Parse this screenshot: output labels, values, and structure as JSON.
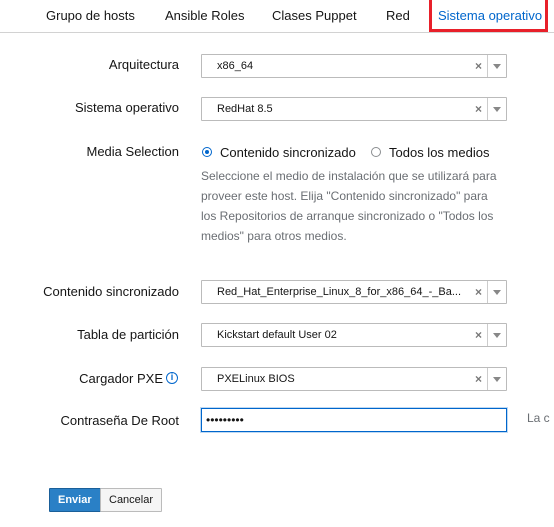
{
  "tabs": {
    "items": [
      {
        "label": "Grupo de hosts"
      },
      {
        "label": "Ansible Roles"
      },
      {
        "label": "Clases Puppet"
      },
      {
        "label": "Red"
      },
      {
        "label": "Sistema operativo",
        "active": true
      }
    ]
  },
  "form": {
    "architecture": {
      "label": "Arquitectura",
      "value": "x86_64"
    },
    "os": {
      "label": "Sistema operativo",
      "value": "RedHat 8.5"
    },
    "media_selection": {
      "label": "Media Selection",
      "options": [
        {
          "label": "Contenido sincronizado",
          "checked": true
        },
        {
          "label": "Todos los medios",
          "checked": false
        }
      ],
      "help": "Seleccione el medio de instalación que se utilizará para proveer este host. Elija \"Contenido sincronizado\" para los Repositorios de arranque sincronizado o \"Todos los medios\" para otros medios."
    },
    "synced_content": {
      "label": "Contenido sincronizado",
      "value": "Red_Hat_Enterprise_Linux_8_for_x86_64_-_Ba..."
    },
    "partition_table": {
      "label": "Tabla de partición",
      "value": "Kickstart default User 02"
    },
    "pxe_loader": {
      "label": "Cargador PXE",
      "value": "PXELinux BIOS",
      "info_icon": "info-circle-icon"
    },
    "root_password": {
      "label": "Contraseña De Root",
      "value": "•••••••••",
      "side_note": "La c"
    }
  },
  "actions": {
    "submit": "Enviar",
    "cancel": "Cancelar"
  },
  "colors": {
    "link": "#0066cc",
    "highlight": "#e8202a",
    "primary_button": "#2a80c6"
  }
}
